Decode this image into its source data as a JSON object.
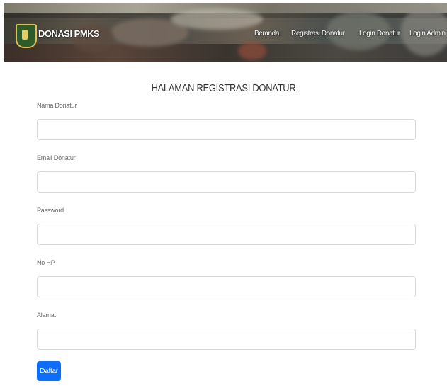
{
  "header": {
    "brand": "DONASI PMKS",
    "nav": [
      "Beranda",
      "Registrasi Donatur",
      "Login Donatur",
      "Login Admin"
    ]
  },
  "form": {
    "title": "HALAMAN REGISTRASI DONATUR",
    "fields": [
      {
        "label": "Nama Donatur",
        "value": "",
        "placeholder": ""
      },
      {
        "label": "Email Donatur",
        "value": "",
        "placeholder": ""
      },
      {
        "label": "Password",
        "value": "",
        "placeholder": ""
      },
      {
        "label": "No HP",
        "value": "",
        "placeholder": ""
      },
      {
        "label": "Alamat",
        "value": "",
        "placeholder": ""
      }
    ],
    "submit_label": "Daftar"
  },
  "colors": {
    "primary": "#0d6efd",
    "input_border": "#d5d9de",
    "emblem_green": "#2f5b2a",
    "emblem_gold": "#d9c35a"
  },
  "icons": [
    "logo-emblem"
  ]
}
